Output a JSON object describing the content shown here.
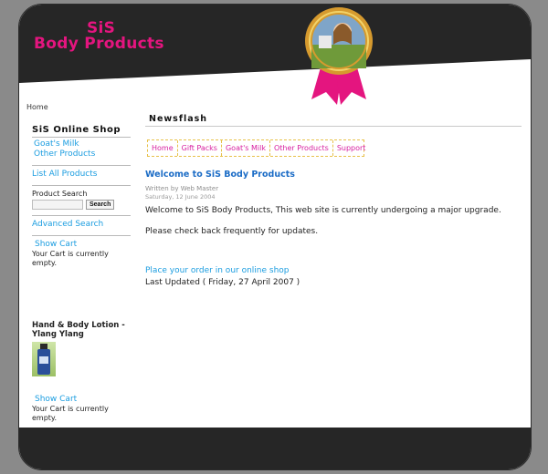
{
  "brand": {
    "line1": "SiS",
    "line2": "Body Products"
  },
  "breadcrumb": "Home",
  "sidebar": {
    "shop_title": "SiS Online Shop",
    "categories": [
      "Goat's Milk",
      "Other Products"
    ],
    "list_all": "List All Products",
    "search_label": "Product Search",
    "search_placeholder": "",
    "search_button": "Search",
    "advanced_search": "Advanced Search",
    "show_cart": "Show Cart",
    "cart_empty": "Your Cart is currently empty.",
    "product_title": "Hand & Body Lotion - Ylang Ylang",
    "show_cart_2": "Show Cart",
    "cart_empty_2": "Your Cart is currently empty."
  },
  "main": {
    "section_title": "Newsflash",
    "tabs": [
      "Home",
      "Gift Packs",
      "Goat's Milk",
      "Other Products",
      "Support"
    ],
    "article_title": "Welcome to SiS Body Products",
    "author": "Written by Web Master",
    "date": "Saturday, 12 June 2004",
    "para1": "Welcome to SiS Body Products, This web site is currently undergoing a major upgrade.",
    "para2": "Please check back frequently for updates.",
    "order_link": "Place your order in our online shop",
    "updated": "Last Updated ( Friday, 27 April 2007 )"
  },
  "colors": {
    "brand_pink": "#e4157f",
    "link_blue": "#1b9de0",
    "title_blue": "#1b6cc6",
    "tab_pink": "#d71fa0"
  }
}
